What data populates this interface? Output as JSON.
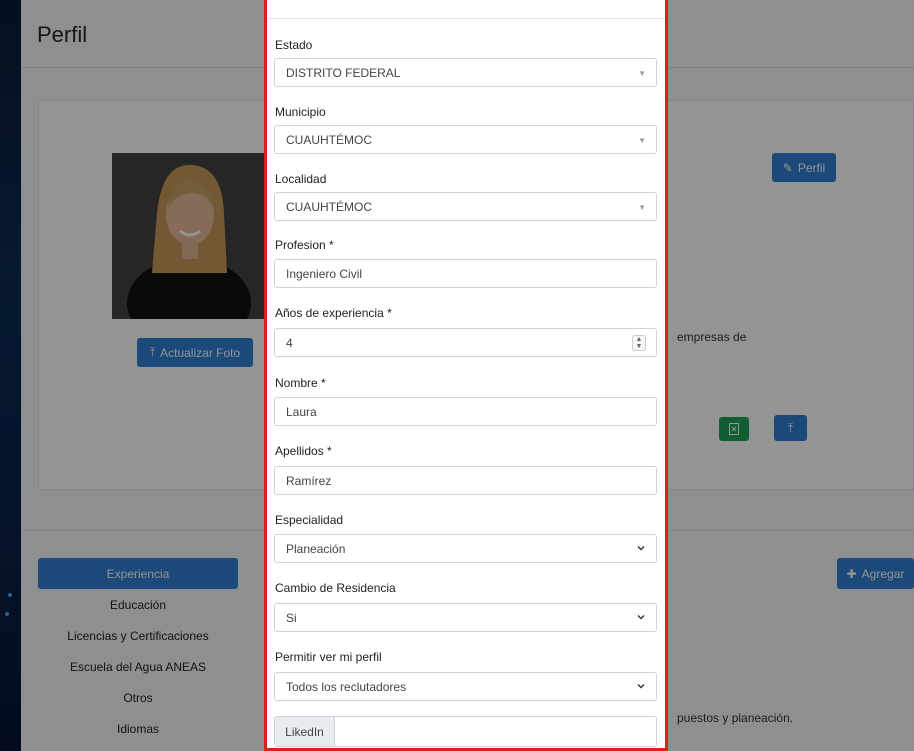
{
  "background": {
    "page_title": "Perfil",
    "actualizar_foto_label": "Actualizar Foto",
    "perfil_button_label": "Perfil",
    "empresas_text": "empresas  de",
    "puestos_text": "puestos y planeación.",
    "agregar_label": "Agregar",
    "tabs": [
      {
        "label": "Experiencia"
      },
      {
        "label": "Educación"
      },
      {
        "label": "Licencias y Certificaciones"
      },
      {
        "label": "Escuela del Agua ANEAS"
      },
      {
        "label": "Otros"
      },
      {
        "label": "Idiomas"
      }
    ]
  },
  "modal": {
    "estado": {
      "label": "Estado",
      "value": "DISTRITO FEDERAL"
    },
    "municipio": {
      "label": "Municipio",
      "value": "CUAUHTÉMOC"
    },
    "localidad": {
      "label": "Localidad",
      "value": "CUAUHTÉMOC"
    },
    "profesion": {
      "label": "Profesion *",
      "value": "Ingeniero Civil"
    },
    "experiencia": {
      "label": "Años de experiencia *",
      "value": "4"
    },
    "nombre": {
      "label": "Nombre *",
      "value": "Laura"
    },
    "apellidos": {
      "label": "Apellidos *",
      "value": "Ramírez"
    },
    "especialidad": {
      "label": "Especialidad",
      "value": "Planeación"
    },
    "residencia": {
      "label": "Cambio de Residencia",
      "value": "Si"
    },
    "permitir": {
      "label": "Permitir ver mi perfil",
      "value": "Todos los reclutadores"
    },
    "linkedin": {
      "addon": "LikedIn",
      "value": ""
    }
  },
  "colors": {
    "primary": "#2f7fd1",
    "success": "#20a357",
    "highlight_border": "#d91f1f"
  }
}
